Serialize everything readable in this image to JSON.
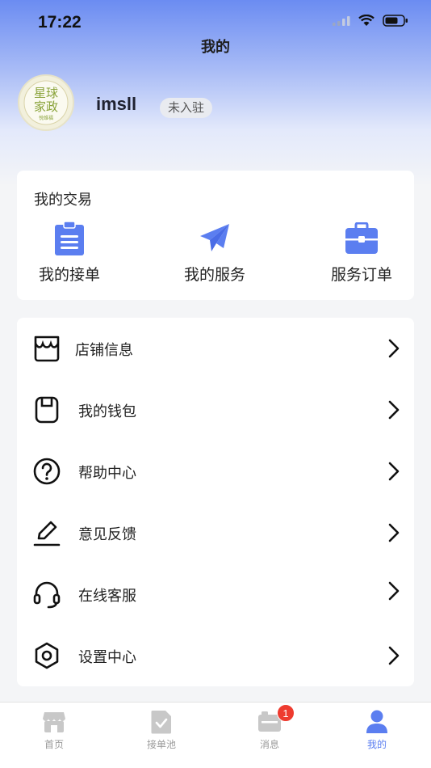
{
  "status_bar": {
    "time": "17:22"
  },
  "nav": {
    "title": "我的"
  },
  "profile": {
    "avatar_text_line1": "星球",
    "avatar_text_line2": "家政",
    "avatar_text_small": "悦维福",
    "username": "imsll",
    "status_badge": "未入驻"
  },
  "trade": {
    "title": "我的交易",
    "items": [
      {
        "label": "我的接单",
        "icon": "clipboard-icon"
      },
      {
        "label": "我的服务",
        "icon": "paper-plane-icon"
      },
      {
        "label": "服务订单",
        "icon": "briefcase-icon"
      }
    ],
    "accent": "#5b7ef0"
  },
  "menu": {
    "items": [
      {
        "label": "店铺信息",
        "icon": "store-icon"
      },
      {
        "label": "我的钱包",
        "icon": "wallet-icon"
      },
      {
        "label": "帮助中心",
        "icon": "help-icon"
      },
      {
        "label": "意见反馈",
        "icon": "pen-icon"
      },
      {
        "label": "在线客服",
        "icon": "headset-icon"
      },
      {
        "label": "设置中心",
        "icon": "settings-icon"
      }
    ]
  },
  "tabbar": {
    "tabs": [
      {
        "label": "首页",
        "icon": "home-store-icon",
        "active": false
      },
      {
        "label": "接单池",
        "icon": "order-pool-icon",
        "active": false
      },
      {
        "label": "消息",
        "icon": "message-icon",
        "active": false,
        "badge": "1"
      },
      {
        "label": "我的",
        "icon": "person-icon",
        "active": true
      }
    ],
    "active_color": "#5b7ef0",
    "inactive_color": "#c8c8c8"
  }
}
